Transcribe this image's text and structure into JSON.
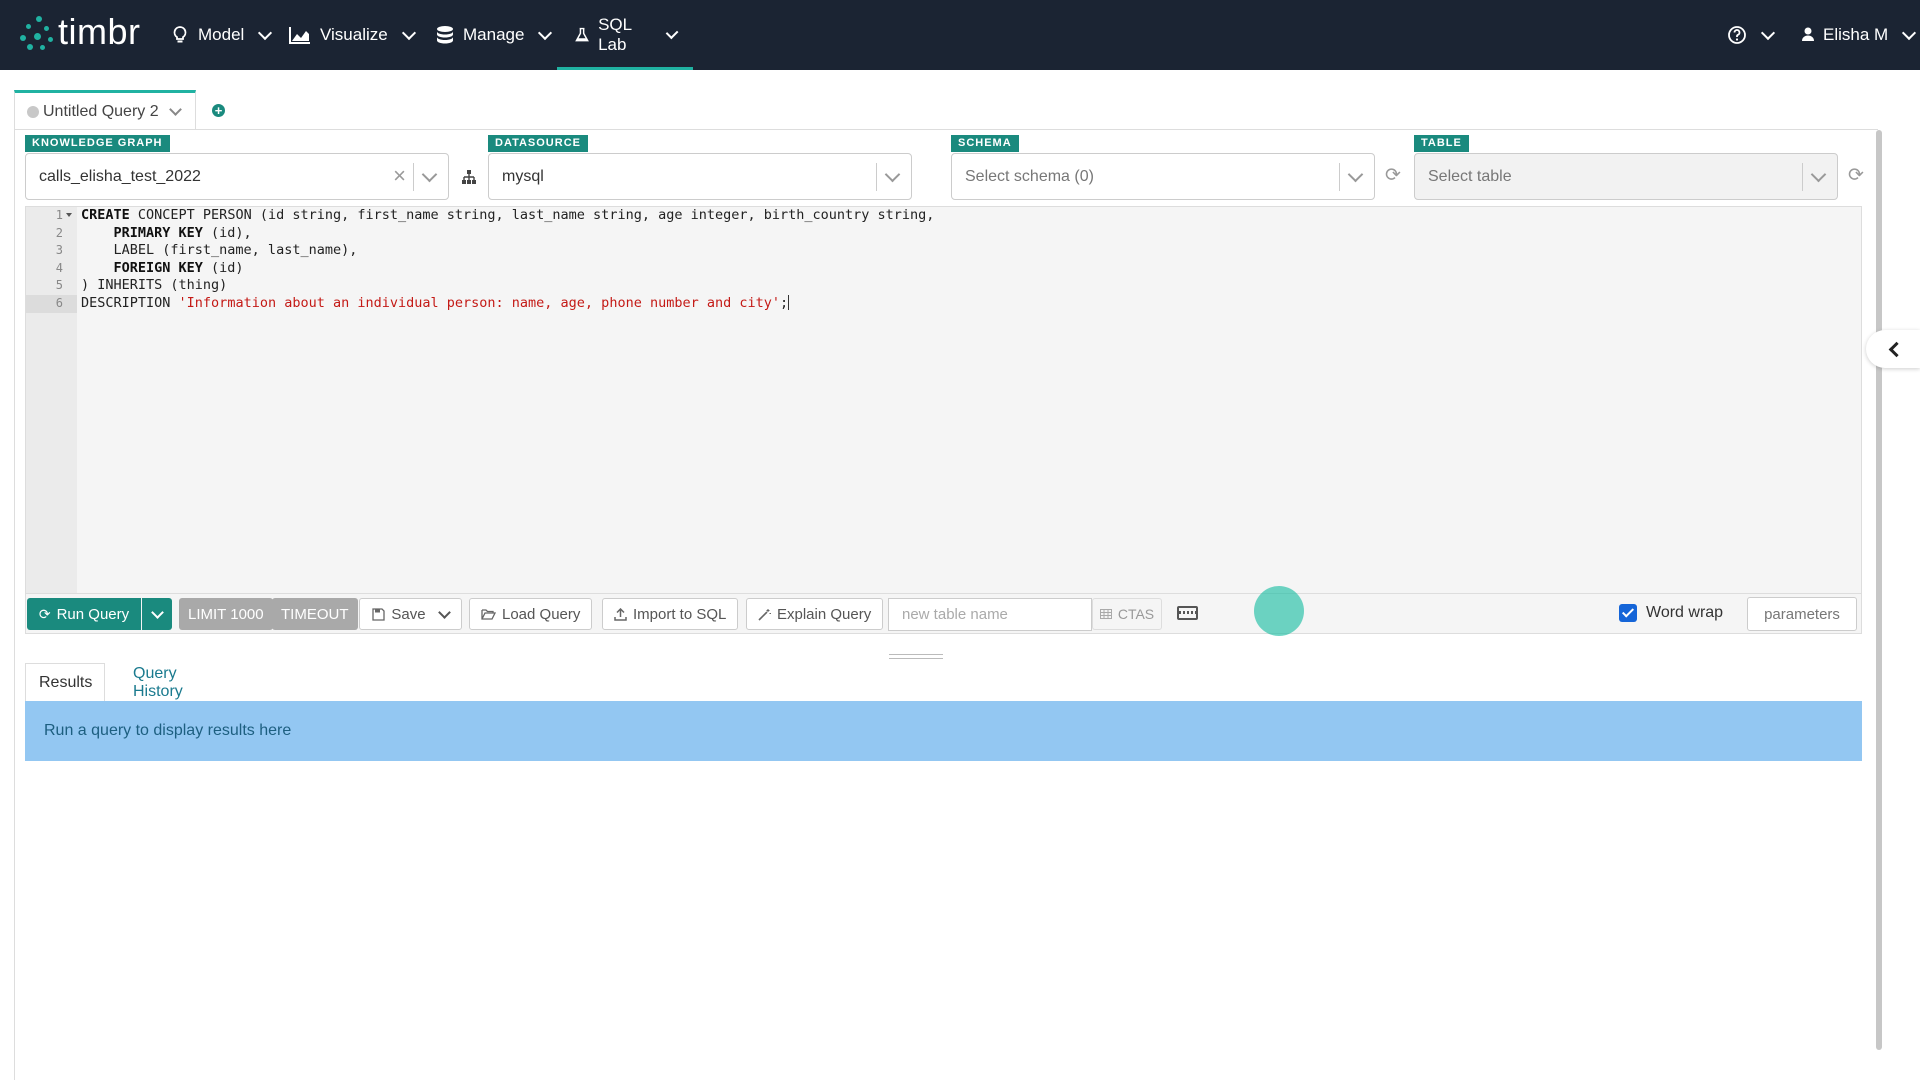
{
  "app": {
    "logo_text": "timbr",
    "brand_color": "#20b2a2",
    "nav_bg": "#1b2433"
  },
  "nav": {
    "items": [
      {
        "label": "Model",
        "icon": "lightbulb-icon"
      },
      {
        "label": "Visualize",
        "icon": "chart-icon"
      },
      {
        "label": "Manage",
        "icon": "database-icon"
      },
      {
        "label": "SQL Lab",
        "icon": "flask-icon",
        "active": true
      }
    ],
    "help_icon": "help-icon",
    "user_name": "Elisha M"
  },
  "query_tabs": {
    "tabs": [
      {
        "label": "Untitled Query 2"
      }
    ],
    "add_icon": "plus-circle-icon"
  },
  "selectors": {
    "knowledge_graph": {
      "label": "KNOWLEDGE GRAPH",
      "value": "calls_elisha_test_2022"
    },
    "datasource": {
      "label": "DATASOURCE",
      "value": "mysql"
    },
    "schema": {
      "label": "SCHEMA",
      "placeholder": "Select schema (0)"
    },
    "table": {
      "label": "TABLE",
      "placeholder": "Select table"
    }
  },
  "editor": {
    "line_numbers": [
      "1",
      "2",
      "3",
      "4",
      "5",
      "6"
    ],
    "lines": [
      [
        {
          "t": "CREATE",
          "k": "kw"
        },
        {
          "t": " CONCEPT PERSON (id string, first_name string, last_name string, age integer, birth_country string,"
        }
      ],
      [
        {
          "t": "    "
        },
        {
          "t": "PRIMARY KEY",
          "k": "kw"
        },
        {
          "t": " (id),"
        }
      ],
      [
        {
          "t": "    LABEL (first_name, last_name),"
        }
      ],
      [
        {
          "t": "    "
        },
        {
          "t": "FOREIGN KEY",
          "k": "kw"
        },
        {
          "t": " (id)"
        }
      ],
      [
        {
          "t": ") INHERITS (thing)"
        }
      ],
      [
        {
          "t": "DESCRIPTION "
        },
        {
          "t": "'Information about an individual person: name, age, phone number and city'",
          "k": "str"
        },
        {
          "t": ";"
        }
      ]
    ]
  },
  "toolbar": {
    "run_label": "Run Query",
    "limit_label": "LIMIT 1000",
    "timeout_label": "TIMEOUT",
    "save_label": "Save",
    "load_label": "Load Query",
    "import_label": "Import to SQL",
    "explain_label": "Explain Query",
    "table_name_placeholder": "new table name",
    "ctas_label": "CTAS",
    "word_wrap_label": "Word wrap",
    "word_wrap_checked": true,
    "parameters_label": "parameters"
  },
  "results": {
    "tabs": [
      "Results",
      "Query History"
    ],
    "empty_message": "Run a query to display results here"
  }
}
